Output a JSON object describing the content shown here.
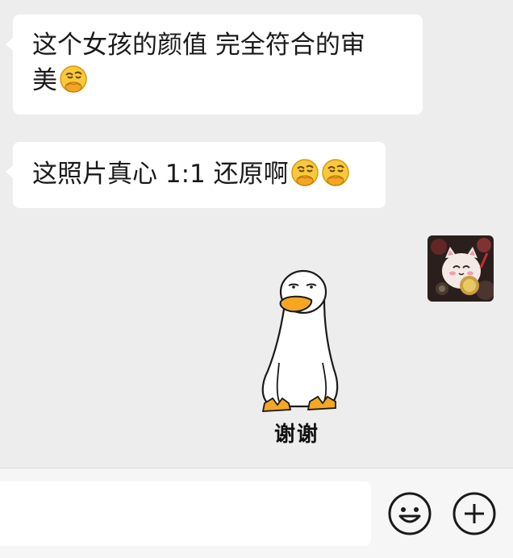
{
  "messages": [
    {
      "sender": "other",
      "text_line1": "这个女孩的颜值 完全符合的审",
      "text_line2": "美",
      "emoji": "thinking-face-emoji"
    },
    {
      "sender": "other",
      "text": "这照片真心 1:1 还原啊",
      "emoji": "thinking-face-emoji"
    },
    {
      "sender": "self",
      "type": "sticker",
      "sticker_icon": "white-duck-sticker",
      "sticker_text": "谢谢"
    }
  ],
  "input_bar": {
    "text_value": "",
    "emoji_button_icon": "smiley-icon",
    "more_button_icon": "plus-circle-icon"
  },
  "colors": {
    "chat_background": "#ededed",
    "bubble_background": "#ffffff",
    "input_bar_background": "#f6f6f6"
  }
}
